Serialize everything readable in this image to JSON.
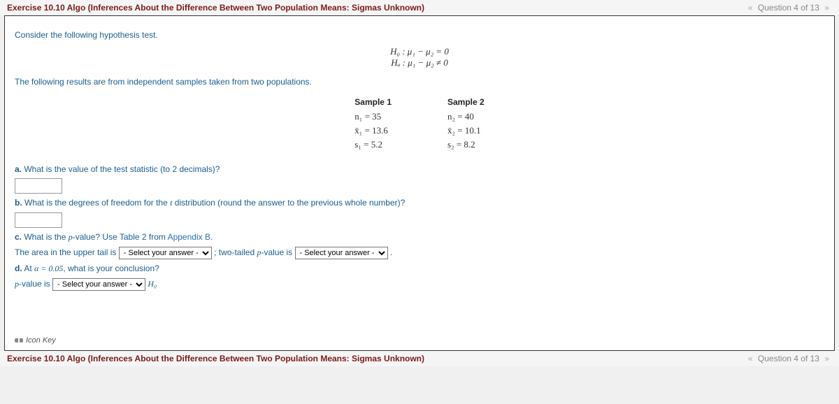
{
  "header": {
    "title": "Exercise 10.10 Algo (Inferences About the Difference Between Two Population Means: Sigmas Unknown)",
    "nav_prev": "«",
    "nav_label": "Question 4 of 13",
    "nav_next": "»"
  },
  "intro": {
    "line1": "Consider the following hypothesis test.",
    "line2": "The following results are from independent samples taken from two populations."
  },
  "hypotheses": {
    "h0": "H₀ : μ₁ − μ₂ = 0",
    "ha": "Hₐ : μ₁ − μ₂ ≠ 0"
  },
  "samples": {
    "col1": {
      "header": "Sample 1",
      "n": "n₁ = 35",
      "xbar": "x̄₁ = 13.6",
      "s": "s₁ = 5.2"
    },
    "col2": {
      "header": "Sample 2",
      "n": "n₂ = 40",
      "xbar": "x̄₂ = 10.1",
      "s": "s₂ = 8.2"
    }
  },
  "parts": {
    "a_label": "a.",
    "a_text": " What is the value of the test statistic (to 2 decimals)?",
    "b_label": "b.",
    "b_text_pre": " What is the degrees of freedom for the ",
    "b_t": "t",
    "b_text_post": " distribution (round the answer to the previous whole number)?",
    "c_label": "c.",
    "c_text_pre": " What is the ",
    "c_p": "p",
    "c_text_post": "-value? Use Table 2 from ",
    "c_appendix": "Appendix B",
    "c_period": ".",
    "c_line2_pre": "The area in the upper tail is ",
    "c_line2_mid": " ; two-tailed ",
    "c_line2_p": "p",
    "c_line2_is": "-value is ",
    "c_line2_end": " .",
    "d_label": "d.",
    "d_text_pre": " At ",
    "d_alpha": "α = 0.05",
    "d_text_post": ", what is your conclusion?",
    "d_line2_p": "p",
    "d_line2_is": "-value is ",
    "d_line2_h0": " H₀"
  },
  "select_placeholder": "- Select your answer -",
  "iconkey": "Icon Key"
}
